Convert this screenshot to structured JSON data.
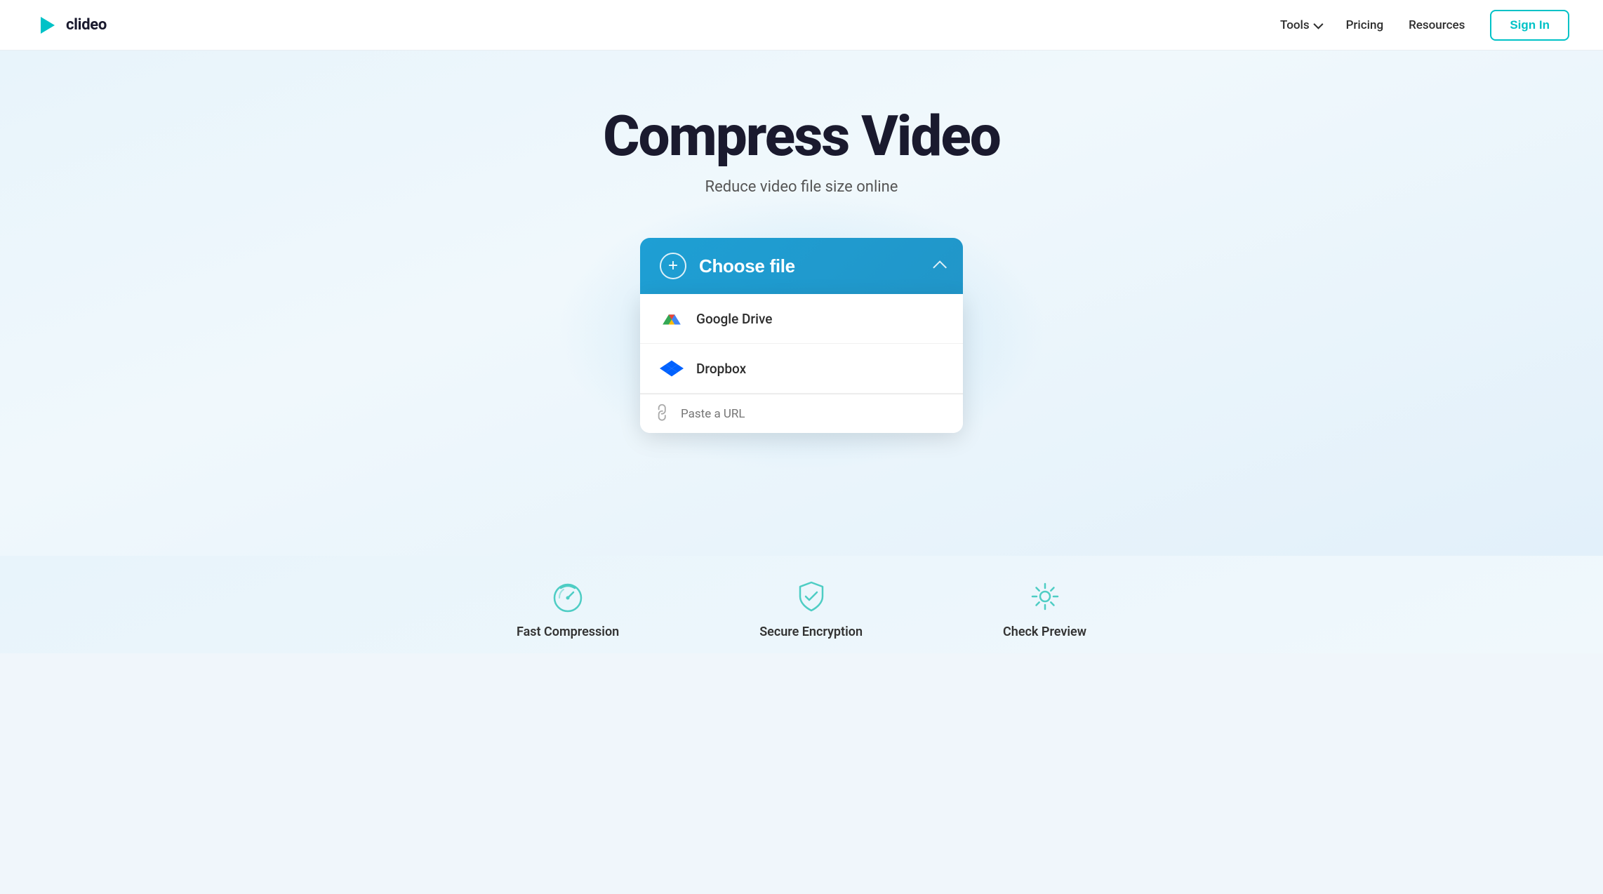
{
  "nav": {
    "logo_text": "clideo",
    "tools_label": "Tools",
    "pricing_label": "Pricing",
    "resources_label": "Resources",
    "signin_label": "Sign In"
  },
  "hero": {
    "title": "Compress Video",
    "subtitle": "Reduce video file size online"
  },
  "file_chooser": {
    "choose_file_label": "Choose file",
    "google_drive_label": "Google Drive",
    "dropbox_label": "Dropbox",
    "url_placeholder": "Paste a URL"
  },
  "features": [
    {
      "label": "Fast Compression",
      "icon": "speed-icon"
    },
    {
      "label": "Secure Encryption",
      "icon": "shield-icon"
    },
    {
      "label": "Check Preview",
      "icon": "gear-icon"
    }
  ],
  "colors": {
    "accent": "#2196c9",
    "teal": "#00c2c7",
    "feature_icon": "#4ecdc4"
  }
}
